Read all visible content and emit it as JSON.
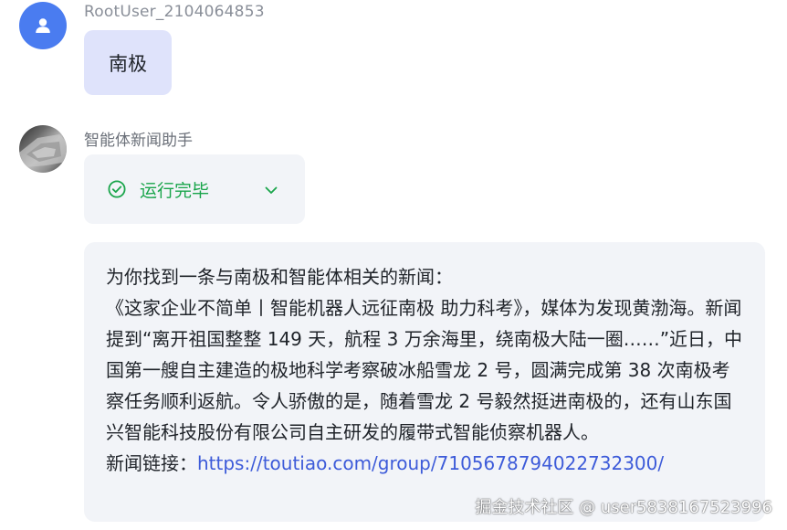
{
  "user_message": {
    "username": "RootUser_2104064853",
    "text": "南极"
  },
  "bot_message": {
    "name": "智能体新闻助手",
    "status": "运行完毕",
    "answer": {
      "intro": "为你找到一条与南极和智能体相关的新闻：",
      "body": "《这家企业不简单丨智能机器人远征南极 助力科考》，媒体为发现黄渤海。新闻提到“离开祖国整整 149 天，航程 3 万余海里，绕南极大陆一圈……”近日，中国第一艘自主建造的极地科学考察破冰船雪龙 2 号，圆满完成第 38 次南极考察任务顺利返航。令人骄傲的是，随着雪龙 2 号毅然挺进南极的，还有山东国兴智能科技股份有限公司自主研发的履带式智能侦察机器人。",
      "link_label": "新闻链接：",
      "link_url": "https://toutiao.com/group/7105678794022732300/"
    }
  },
  "watermark": "掘金技术社区 @ user5838167523996",
  "colors": {
    "user_avatar": "#4a7cf0",
    "user_bubble": "#dfe3fb",
    "card_bg": "#f2f4f8",
    "status_green": "#1aa54b",
    "link": "#3d5bd9"
  },
  "icons": {
    "user_avatar": "person-icon",
    "status": "check-circle-icon",
    "expand": "chevron-down-icon"
  }
}
